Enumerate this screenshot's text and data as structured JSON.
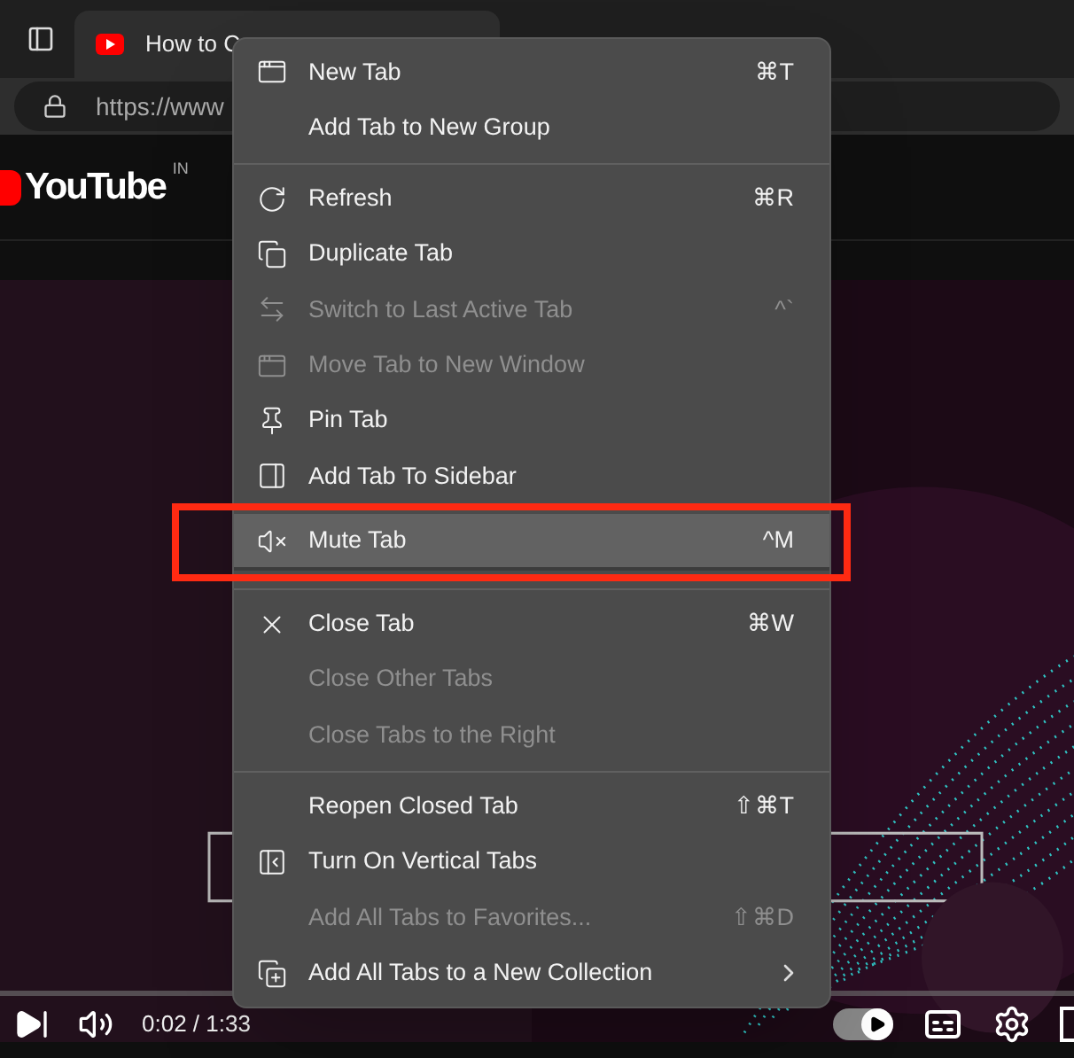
{
  "browser": {
    "tab": {
      "title": "How to C"
    },
    "address": {
      "url": "https://www"
    }
  },
  "site": {
    "logo": "YouTube",
    "region": "IN"
  },
  "player": {
    "time": "0:02 / 1:33",
    "autoplay": {
      "on": true
    }
  },
  "menu": {
    "sections": [
      [
        {
          "label": "New Tab",
          "shortcut": "⌘T",
          "disabled": false,
          "selected": false,
          "submenu": false
        },
        {
          "label": "Add Tab to New Group",
          "disabled": false,
          "selected": false,
          "submenu": false
        }
      ],
      [
        {
          "label": "Refresh",
          "shortcut": "⌘R",
          "disabled": false,
          "selected": false,
          "submenu": false
        },
        {
          "label": "Duplicate Tab",
          "disabled": false,
          "selected": false,
          "submenu": false
        },
        {
          "label": "Switch to Last Active Tab",
          "shortcut": "^`",
          "disabled": true,
          "selected": false,
          "submenu": false
        },
        {
          "label": "Move Tab to New Window",
          "disabled": true,
          "selected": false,
          "submenu": false
        },
        {
          "label": "Pin Tab",
          "disabled": false,
          "selected": false,
          "submenu": false
        },
        {
          "label": "Add Tab To Sidebar",
          "disabled": false,
          "selected": false,
          "submenu": false
        },
        {
          "label": "Mute Tab",
          "shortcut": "^M",
          "disabled": false,
          "selected": true,
          "submenu": false
        }
      ],
      [
        {
          "label": "Close Tab",
          "shortcut": "⌘W",
          "disabled": false,
          "selected": false,
          "submenu": false
        },
        {
          "label": "Close Other Tabs",
          "disabled": true,
          "selected": false,
          "submenu": false
        },
        {
          "label": "Close Tabs to the Right",
          "disabled": true,
          "selected": false,
          "submenu": false
        }
      ],
      [
        {
          "label": "Reopen Closed Tab",
          "shortcut": "⇧⌘T",
          "disabled": false,
          "selected": false,
          "submenu": false
        },
        {
          "label": "Turn On Vertical Tabs",
          "disabled": false,
          "selected": false,
          "submenu": false
        },
        {
          "label": "Add All Tabs to Favorites...",
          "shortcut": "⇧⌘D",
          "disabled": true,
          "selected": false,
          "submenu": false
        },
        {
          "label": "Add All Tabs to a New Collection",
          "disabled": false,
          "selected": false,
          "submenu": true
        }
      ]
    ]
  }
}
